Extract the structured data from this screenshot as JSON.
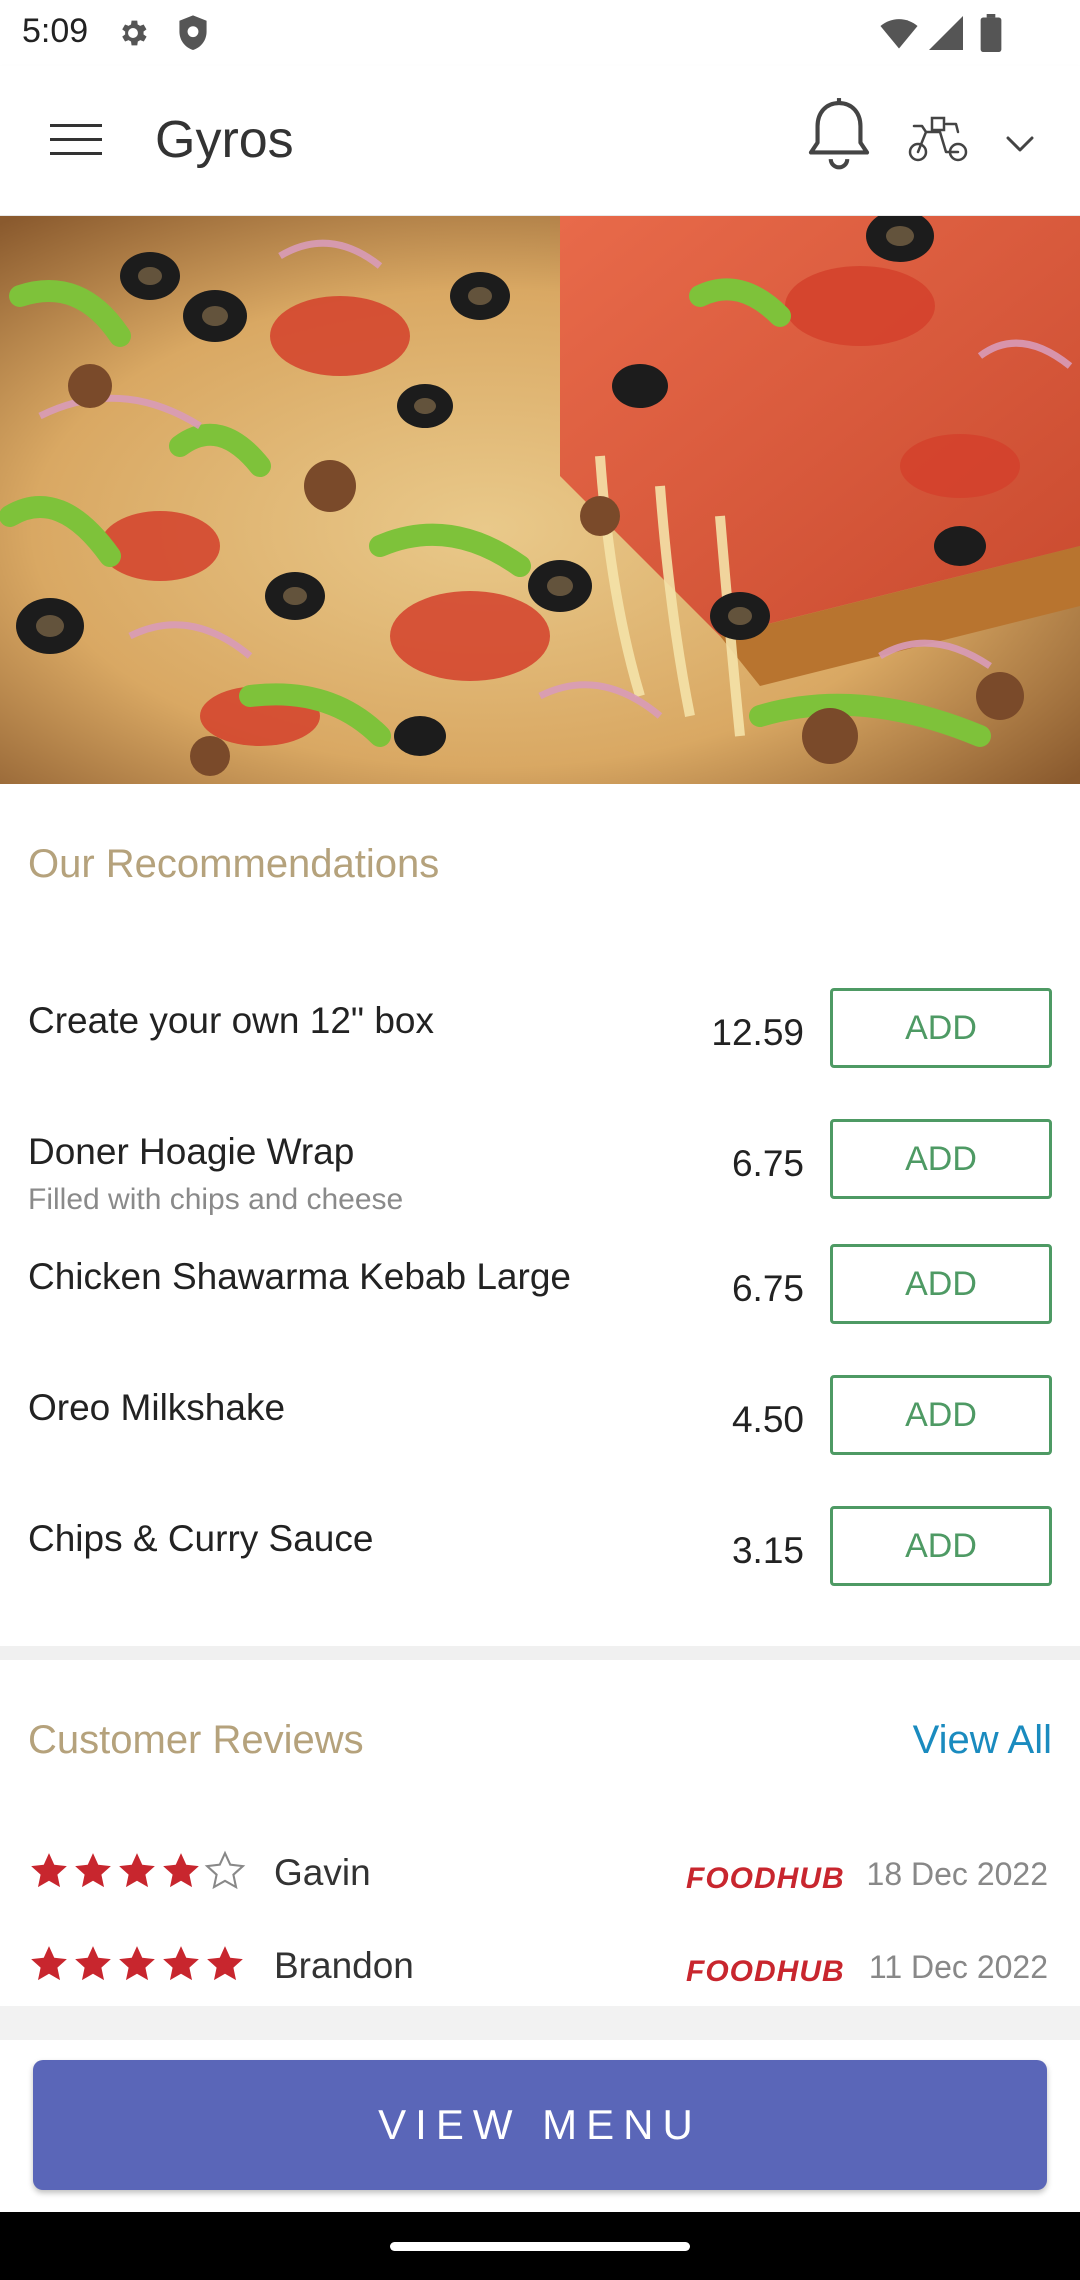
{
  "status_bar": {
    "time": "5:09",
    "icons": [
      "gear-icon",
      "shield-icon",
      "wifi-icon",
      "signal-icon",
      "battery-icon"
    ]
  },
  "app_bar": {
    "title": "Gyros",
    "icons": [
      "hamburger-menu-icon",
      "bell-icon",
      "scooter-icon",
      "chevron-down-icon"
    ]
  },
  "hero": {
    "alt": "pizza-photo"
  },
  "recommendations": {
    "title": "Our Recommendations",
    "add_label": "ADD",
    "items": [
      {
        "name": "Create your own 12\" box",
        "desc": "",
        "price": "12.59"
      },
      {
        "name": "Doner Hoagie Wrap",
        "desc": "Filled with chips and cheese",
        "price": "6.75"
      },
      {
        "name": "Chicken Shawarma Kebab Large",
        "desc": "",
        "price": "6.75"
      },
      {
        "name": "Oreo Milkshake",
        "desc": "",
        "price": "4.50"
      },
      {
        "name": "Chips & Curry Sauce",
        "desc": "",
        "price": "3.15"
      }
    ]
  },
  "reviews": {
    "title": "Customer Reviews",
    "view_all_label": "View All",
    "source_logo": "FOODHUB",
    "items": [
      {
        "name": "Gavin",
        "date": "18 Dec 2022",
        "rating": 4
      },
      {
        "name": "Brandon",
        "date": "11 Dec 2022",
        "rating": 5
      }
    ]
  },
  "cta": {
    "label": "VIEW MENU"
  },
  "colors": {
    "accent_green": "#4e9a64",
    "section_title": "#b5a27c",
    "link_blue": "#1a8bbf",
    "button_blue": "#5a66b8",
    "star_red": "#c8262e"
  }
}
